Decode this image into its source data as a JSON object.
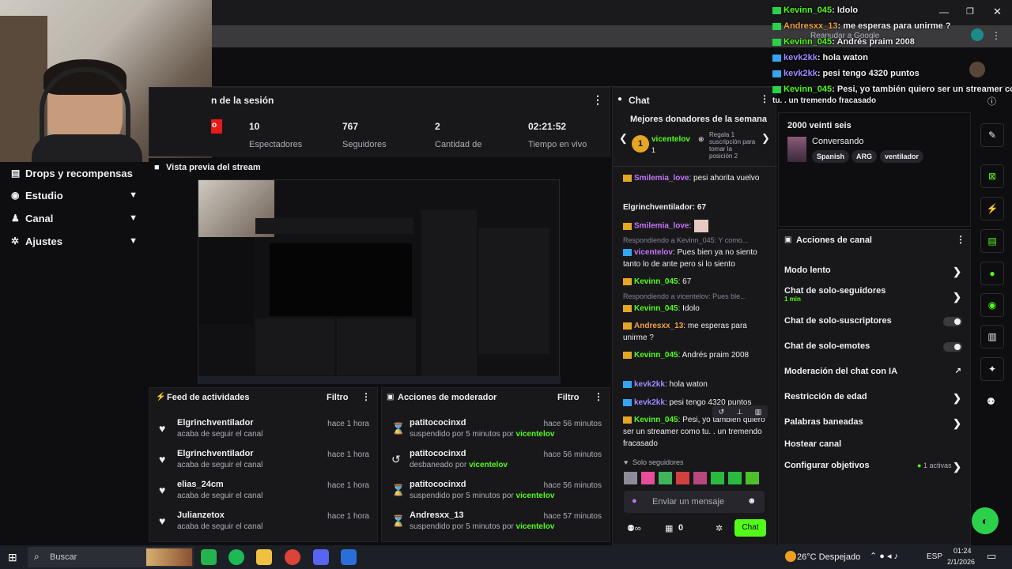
{
  "colors": {
    "accent": "#53fc18",
    "bg": "#0e0e10",
    "panel": "#18181b",
    "gold": "#e5a624",
    "blue": "#36a4f0"
  },
  "left_nav": [
    {
      "label": "Drops y recompensas",
      "icon": "gift-icon"
    },
    {
      "label": "Estudio",
      "icon": "studio-icon"
    },
    {
      "label": "Canal",
      "icon": "channel-icon"
    },
    {
      "label": "Ajustes",
      "icon": "gear-icon"
    }
  ],
  "session": {
    "title": "n de la sesión",
    "live_badge": "o",
    "stats": [
      {
        "value": "10",
        "label": "Espectadores"
      },
      {
        "value": "767",
        "label": "Seguidores"
      },
      {
        "value": "2",
        "label": "Cantidad de"
      },
      {
        "value": "02:21:52",
        "label": "Tiempo en vivo"
      }
    ]
  },
  "preview": {
    "title": "Vista previa del stream"
  },
  "feed": {
    "title": "Feed de actividades",
    "filter": "Filtro",
    "items": [
      {
        "name": "Elgrinchventilador",
        "sub": "acaba de seguir el canal",
        "time": "hace 1 hora"
      },
      {
        "name": "Elgrinchventilador",
        "sub": "acaba de seguir el canal",
        "time": "hace 1 hora"
      },
      {
        "name": "elias_24cm",
        "sub": "acaba de seguir el canal",
        "time": "hace 1 hora"
      },
      {
        "name": "Julianzetox",
        "sub": "acaba de seguir el canal",
        "time": "hace 1 hora"
      }
    ]
  },
  "mod_actions": {
    "title": "Acciones de moderador",
    "filter": "Filtro",
    "items": [
      {
        "name": "patitococinxd",
        "action": "suspendido por 5 minutos por ",
        "by": "vicentelov",
        "time": "hace 56 minutos"
      },
      {
        "name": "patitococinxd",
        "action": "desbaneado por ",
        "by": "vicentelov",
        "time": "hace 56 minutos"
      },
      {
        "name": "patitococinxd",
        "action": "suspendido por 5 minutos por ",
        "by": "vicentelov",
        "time": "hace 56 minutos"
      },
      {
        "name": "Andresxx_13",
        "action": "suspendido por 5 minutos por ",
        "by": "vicentelov",
        "time": "hace 57 minutos"
      }
    ]
  },
  "chat": {
    "title": "Chat",
    "top_donors_title": "Mejores donadores de la semana",
    "top_donor": {
      "name": "vicentelov",
      "count": "1",
      "rank": "1"
    },
    "gift_prompt": "Regala 1 suscripción para tomar la posición 2",
    "messages": [
      {
        "user": "Smilemia_love",
        "text": ": pesi ahorita vuelvo"
      },
      {
        "user": "Elgrinchventilador",
        "text": ": 67"
      },
      {
        "user": "Smilemia_love",
        "text": ":"
      },
      {
        "reply": "Respondiendo a Kevinn_045: Y como...",
        "user": "vicentelov",
        "text": ": Pues bien ya no siento tanto lo de ante pero si lo siento"
      },
      {
        "user": "Kevinn_045",
        "text": ": 67"
      },
      {
        "reply": "Respondiendo a vicentelov: Pues ble...",
        "user": "Kevinn_045",
        "text": ": Idolo"
      },
      {
        "user": "Andresxx_13",
        "text": ": me esperas para unirme ?"
      },
      {
        "user": "Kevinn_045",
        "text": ": Andrés praim 2008"
      },
      {
        "user": "kevk2kk",
        "text": ": hola waton"
      },
      {
        "user": "kevk2kk",
        "text": ": pesi tengo 4320 puntos"
      },
      {
        "user": "Kevinn_045",
        "text": ": Pesi, yo tambien quiero ser un streamer como tu. . un tremendo fracasado"
      }
    ],
    "followers_only": "Solo seguidores",
    "input_placeholder": "Enviar un mensaje",
    "points": "0",
    "send_label": "Chat"
  },
  "stream_info": {
    "title": "2000 veinti seis",
    "category": "Conversando",
    "tags": [
      "Spanish",
      "ARG",
      "ventilador"
    ]
  },
  "channel_actions": {
    "title": "Acciones de canal",
    "items": [
      {
        "label": "Modo lento",
        "type": "chevron"
      },
      {
        "label": "Chat de solo-seguidores",
        "sub": "1 min",
        "type": "chevron"
      },
      {
        "label": "Chat de solo-suscriptores",
        "type": "toggle"
      },
      {
        "label": "Chat de solo-emotes",
        "type": "toggle"
      },
      {
        "label": "Moderación del chat con IA",
        "type": "external"
      },
      {
        "label": "Restricción de edad",
        "type": "chevron"
      },
      {
        "label": "Palabras baneadas",
        "type": "chevron"
      },
      {
        "label": "Hostear canal",
        "type": "none"
      },
      {
        "label": "Configurar objetivos",
        "extra": "1 activas",
        "type": "chevron"
      }
    ]
  },
  "overlay": [
    {
      "user": "Kevinn_045",
      "text": ": Idolo"
    },
    {
      "user": "Andresxx_13",
      "text": ": me esperas para unirme ?"
    },
    {
      "user": "Kevinn_045",
      "text": ": Andrés praim 2008"
    },
    {
      "user": "kevk2kk",
      "text": ": hola waton"
    },
    {
      "user": "kevk2kk",
      "text": ": pesi tengo 4320 puntos"
    },
    {
      "user": "Kevinn_045",
      "text": ": Pesi, yo también quiero ser un streamer como"
    },
    {
      "user": "",
      "text": "tu. . un tremendo fracasado"
    }
  ],
  "browser": {
    "tab_hint": "Reanudar a Google"
  },
  "taskbar": {
    "search": "Buscar",
    "weather": "26°C  Despejado",
    "lang": "ESP",
    "time": "01:24",
    "date": "2/1/2026"
  }
}
